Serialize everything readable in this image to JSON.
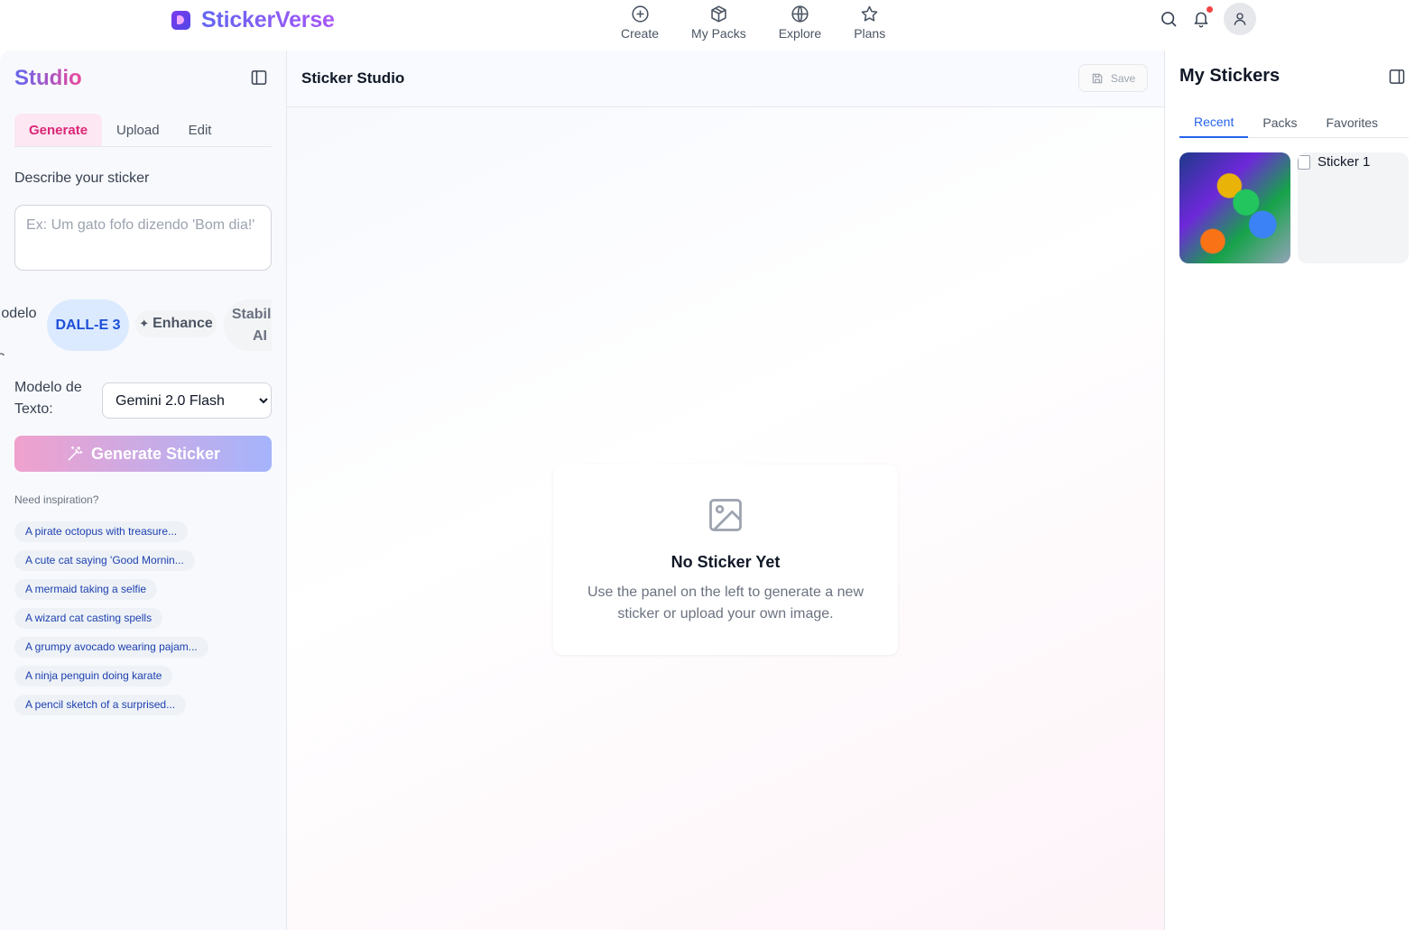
{
  "app": {
    "name": "StickerVerse"
  },
  "nav": {
    "items": [
      {
        "label": "Create",
        "icon": "plus-circle-icon"
      },
      {
        "label": "My Packs",
        "icon": "package-icon"
      },
      {
        "label": "Explore",
        "icon": "globe-icon"
      },
      {
        "label": "Plans",
        "icon": "star-icon"
      }
    ]
  },
  "header_icons": {
    "search": "search-icon",
    "notifications": "bell-icon",
    "has_unread_notifications": true,
    "account": "user-icon"
  },
  "left_panel": {
    "title": "Studio",
    "tabs": [
      "Generate",
      "Upload",
      "Edit"
    ],
    "active_tab": "Generate",
    "prompt_label": "Describe your sticker",
    "prompt_value": "",
    "prompt_placeholder": "Ex: Um gato fofo dizendo 'Bom dia!'",
    "image_model_label": "Modelo de Imagem:",
    "image_models": [
      "DALL-E 3",
      "Enhance",
      "Stability AI"
    ],
    "selected_image_model": "DALL-E 3",
    "text_model_label": "Modelo de Texto:",
    "text_model_value": "Gemini 2.0 Flash",
    "generate_button": "Generate Sticker",
    "inspiration_label": "Need inspiration?",
    "suggestions": [
      "A pirate octopus with treasure...",
      "A cute cat saying 'Good Mornin...",
      "A mermaid taking a selfie",
      "A wizard cat casting spells",
      "A grumpy avocado wearing pajam...",
      "A ninja penguin doing karate",
      "A pencil sketch of a surprised..."
    ]
  },
  "center": {
    "title": "Sticker Studio",
    "save_label": "Save",
    "empty_title": "No Sticker Yet",
    "empty_description": "Use the panel on the left to generate a new sticker or upload your own image."
  },
  "right_panel": {
    "title": "My Stickers",
    "tabs": [
      "Recent",
      "Packs",
      "Favorites"
    ],
    "active_tab": "Recent",
    "stickers": [
      {
        "alt": "Sticker 0",
        "loaded": true
      },
      {
        "alt": "Sticker 1",
        "loaded": false
      }
    ]
  },
  "colors": {
    "brand": "#6366f1",
    "accent_pink": "#db2777",
    "accent_blue": "#2563eb",
    "notification_dot": "#ef4444"
  }
}
